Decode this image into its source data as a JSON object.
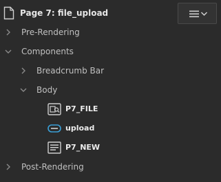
{
  "header": {
    "title": "Page 7: file_upload",
    "page_icon": "page-icon",
    "menu_icon": "hamburger-menu-icon"
  },
  "tree": {
    "pre_rendering": {
      "label": "Pre-Rendering",
      "expanded": false
    },
    "components": {
      "label": "Components",
      "expanded": true
    },
    "breadcrumb_bar": {
      "label": "Breadcrumb Bar",
      "expanded": false
    },
    "body": {
      "label": "Body",
      "expanded": true
    },
    "items": [
      {
        "label": "P7_FILE",
        "icon": "file-browse-icon"
      },
      {
        "label": "upload",
        "icon": "button-icon"
      },
      {
        "label": "P7_NEW",
        "icon": "text-field-icon"
      }
    ],
    "post_rendering": {
      "label": "Post-Rendering",
      "expanded": false
    }
  },
  "colors": {
    "background": "#2b2b2b",
    "text": "#c0c0c0",
    "accent": "#3aa0d8"
  }
}
